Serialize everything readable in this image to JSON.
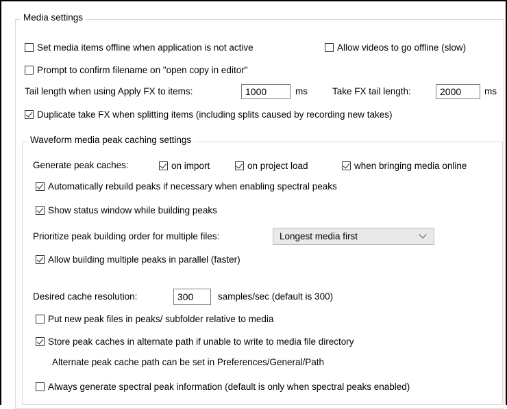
{
  "media_settings": {
    "title": "Media settings",
    "offline_inactive": {
      "label": "Set media items offline when application is not active",
      "checked": false
    },
    "allow_videos_offline": {
      "label": "Allow videos to go offline (slow)",
      "checked": false
    },
    "prompt_confirm_filename": {
      "label": "Prompt to confirm filename on \"open copy in editor\"",
      "checked": false
    },
    "tail_length": {
      "label": "Tail length when using Apply FX to items:",
      "value": "1000",
      "unit": "ms"
    },
    "take_fx_tail": {
      "label": "Take FX tail length:",
      "value": "2000",
      "unit": "ms"
    },
    "duplicate_take_fx": {
      "label": "Duplicate take FX when splitting items (including splits caused by recording new takes)",
      "checked": true
    }
  },
  "peak_caching": {
    "title": "Waveform media peak caching settings",
    "generate_label": "Generate peak caches:",
    "on_import": {
      "label": "on import",
      "checked": true
    },
    "on_project_load": {
      "label": "on project load",
      "checked": true
    },
    "when_online": {
      "label": "when bringing media online",
      "checked": true
    },
    "auto_rebuild": {
      "label": "Automatically rebuild peaks if necessary when enabling spectral peaks",
      "checked": true
    },
    "show_status": {
      "label": "Show status window while building peaks",
      "checked": true
    },
    "prioritize": {
      "label": "Prioritize peak building order for multiple files:",
      "selected": "Longest media first"
    },
    "parallel": {
      "label": "Allow building multiple peaks in parallel (faster)",
      "checked": true
    },
    "cache_resolution": {
      "label": "Desired cache resolution:",
      "value": "300",
      "unit": "samples/sec (default is 300)"
    },
    "subfolder": {
      "label": "Put new peak files in peaks/ subfolder relative to media",
      "checked": false
    },
    "alternate_path": {
      "label": "Store peak caches in alternate path if unable to write to media file directory",
      "checked": true
    },
    "alternate_note": "Alternate peak cache path can be set in Preferences/General/Path",
    "always_spectral": {
      "label": "Always generate spectral peak information (default is only when spectral peaks enabled)",
      "checked": false
    }
  }
}
